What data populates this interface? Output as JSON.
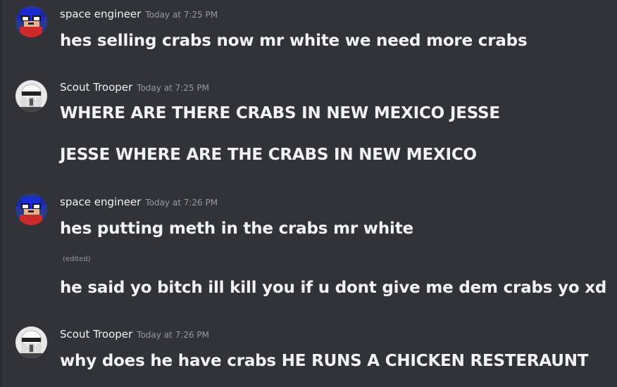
{
  "groups": [
    {
      "username": "space engineer",
      "timestamp": "Today at 7:25 PM",
      "lines": [
        "hes selling crabs now mr white we need more crabs"
      ]
    },
    {
      "username": "Scout Trooper",
      "timestamp": "Today at 7:25 PM",
      "lines": [
        "WHERE ARE THERE CRABS IN NEW MEXICO JESSE",
        "JESSE WHERE ARE THE CRABS IN NEW MEXICO"
      ]
    },
    {
      "username": "space engineer",
      "timestamp": "Today at 7:26 PM",
      "lines": [
        "hes putting meth in the crabs mr white",
        "he said yo bitch ill kill you if u dont give me dem crabs yo xd"
      ],
      "edited_label": "(edited)"
    },
    {
      "username": "Scout Trooper",
      "timestamp": "Today at 7:26 PM",
      "lines": [
        "why does he have crabs HE RUNS A CHICKEN RESTERAUNT"
      ]
    }
  ],
  "avatars": {
    "space_engineer": "sonic-minecraft-avatar-icon",
    "scout_trooper": "scout-trooper-helmet-avatar-icon"
  },
  "colors": {
    "background": "#313338",
    "text": "#f2f3f5",
    "muted": "#949ba4"
  }
}
